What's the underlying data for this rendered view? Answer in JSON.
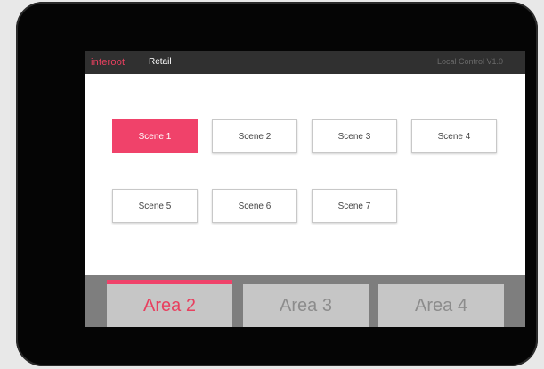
{
  "header": {
    "brand": "interoot",
    "app_name": "Retail",
    "version": "Local Control V1.0"
  },
  "scenes": [
    {
      "label": "Scene 1",
      "active": true
    },
    {
      "label": "Scene 2",
      "active": false
    },
    {
      "label": "Scene 3",
      "active": false
    },
    {
      "label": "Scene 4",
      "active": false
    },
    {
      "label": "Scene 5",
      "active": false
    },
    {
      "label": "Scene 6",
      "active": false
    },
    {
      "label": "Scene 7",
      "active": false
    }
  ],
  "areas": [
    {
      "label": "Area 2",
      "active": true
    },
    {
      "label": "Area 3",
      "active": false
    },
    {
      "label": "Area 4",
      "active": false
    }
  ],
  "colors": {
    "accent": "#f0426a",
    "topbar": "#303030",
    "bezel": "#050505"
  }
}
